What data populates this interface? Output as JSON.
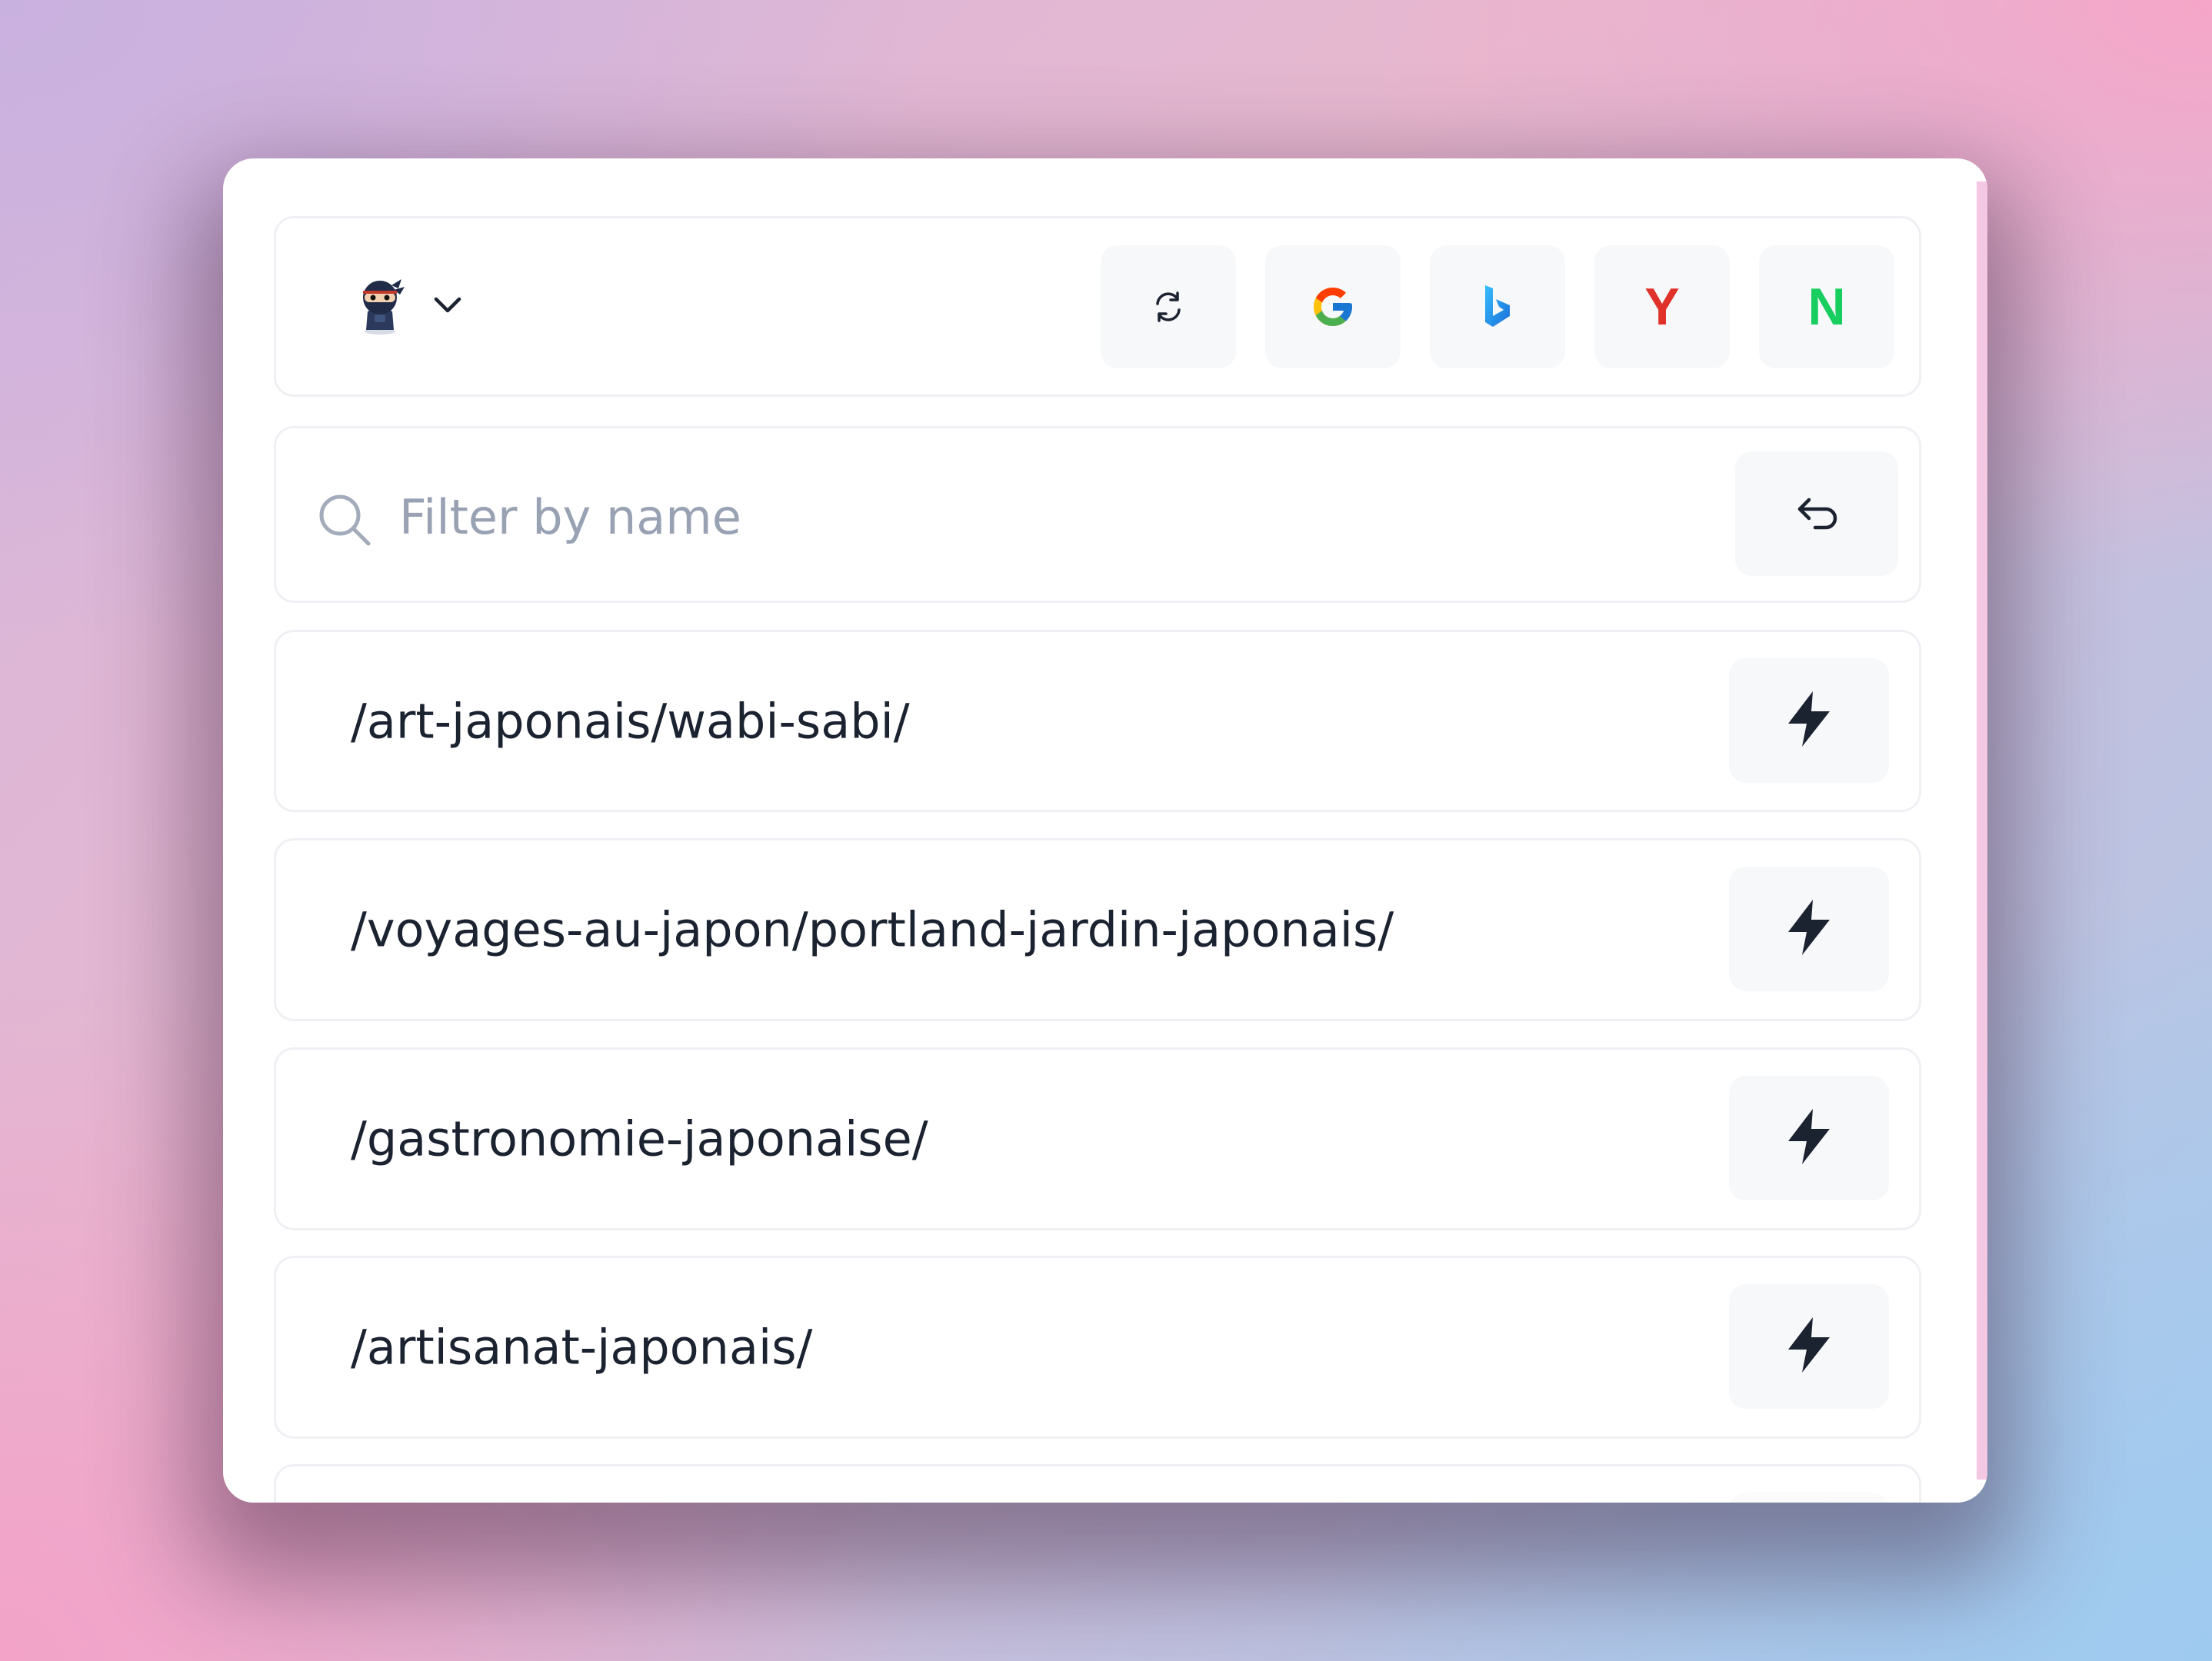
{
  "header": {
    "avatar": "ninja-avatar-icon",
    "menu_icon": "chevron-down-icon",
    "buttons": [
      {
        "name": "refresh",
        "icon": "refresh-icon"
      },
      {
        "name": "google",
        "icon": "google-icon",
        "letter": "G",
        "color": "#4285F4"
      },
      {
        "name": "bing",
        "icon": "bing-icon",
        "letter": "b",
        "color": "#1a9de0"
      },
      {
        "name": "yandex",
        "icon": "yandex-icon",
        "letter": "Y",
        "color": "#e0312b"
      },
      {
        "name": "naver",
        "icon": "naver-icon",
        "letter": "N",
        "color": "#19ce60"
      }
    ]
  },
  "search": {
    "placeholder": "Filter by name",
    "value": "",
    "icon": "search-icon",
    "submit_icon": "return-arrow-icon"
  },
  "rows": [
    {
      "path": "/art-japonais/wabi-sabi/",
      "action_icon": "lightning-bolt-icon"
    },
    {
      "path": "/voyages-au-japon/portland-jardin-japonais/",
      "action_icon": "lightning-bolt-icon"
    },
    {
      "path": "/gastronomie-japonaise/",
      "action_icon": "lightning-bolt-icon"
    },
    {
      "path": "/artisanat-japonais/",
      "action_icon": "lightning-bolt-icon"
    }
  ],
  "colors": {
    "text": "#1b2230",
    "placeholder": "#98a2b3",
    "button_bg": "#f7f8fa",
    "card_border": "#eef0f3"
  }
}
